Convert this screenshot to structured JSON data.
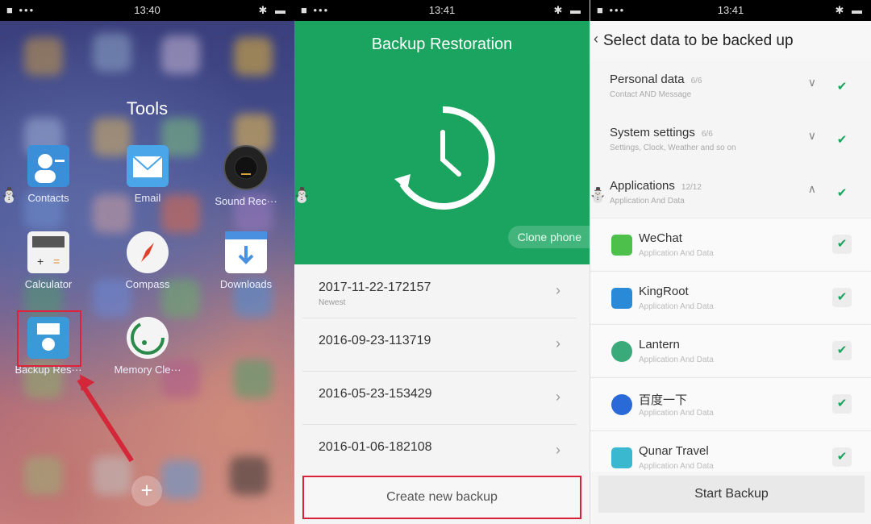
{
  "panel1": {
    "status": {
      "left": "■ •••",
      "time": "13:40",
      "right": "✱ ▬"
    },
    "folder_title": "Tools",
    "apps": [
      {
        "label": "Contacts"
      },
      {
        "label": "Email"
      },
      {
        "label": "Sound Rec···"
      },
      {
        "label": "Calculator"
      },
      {
        "label": "Compass"
      },
      {
        "label": "Downloads"
      },
      {
        "label": "Backup Res···"
      },
      {
        "label": "Memory Cle···"
      }
    ],
    "plus": "+"
  },
  "panel2": {
    "status": {
      "left": "■ •••",
      "time": "13:41",
      "right": "✱ ▬"
    },
    "title": "Backup Restoration",
    "clone": "Clone phone",
    "backups": [
      {
        "name": "2017-11-22-172157",
        "sub": "Newest"
      },
      {
        "name": "2016-09-23-113719",
        "sub": ""
      },
      {
        "name": "2016-05-23-153429",
        "sub": ""
      },
      {
        "name": "2016-01-06-182108",
        "sub": ""
      }
    ],
    "create_label": "Create new backup"
  },
  "panel3": {
    "status": {
      "left": "■ •••",
      "time": "13:41",
      "right": "✱ ▬"
    },
    "back": "‹",
    "title": "Select data to be backed up",
    "categories": [
      {
        "name": "Personal data",
        "count": "6/6",
        "desc": "Contact AND Message",
        "toggle": "∨"
      },
      {
        "name": "System settings",
        "count": "6/6",
        "desc": "Settings, Clock, Weather and so on",
        "toggle": "∨"
      },
      {
        "name": "Applications",
        "count": "12/12",
        "desc": "Application And Data",
        "toggle": "∧"
      }
    ],
    "apps": [
      {
        "name": "WeChat",
        "desc": "Application And Data"
      },
      {
        "name": "KingRoot",
        "desc": "Application And Data"
      },
      {
        "name": "Lantern",
        "desc": "Application And Data"
      },
      {
        "name": "百度一下",
        "desc": "Application And Data"
      },
      {
        "name": "Qunar Travel",
        "desc": "Application And Data"
      }
    ],
    "check": "✔",
    "start_label": "Start Backup"
  },
  "colors": {
    "green": "#1aa45f",
    "highlight": "#d8213a"
  }
}
